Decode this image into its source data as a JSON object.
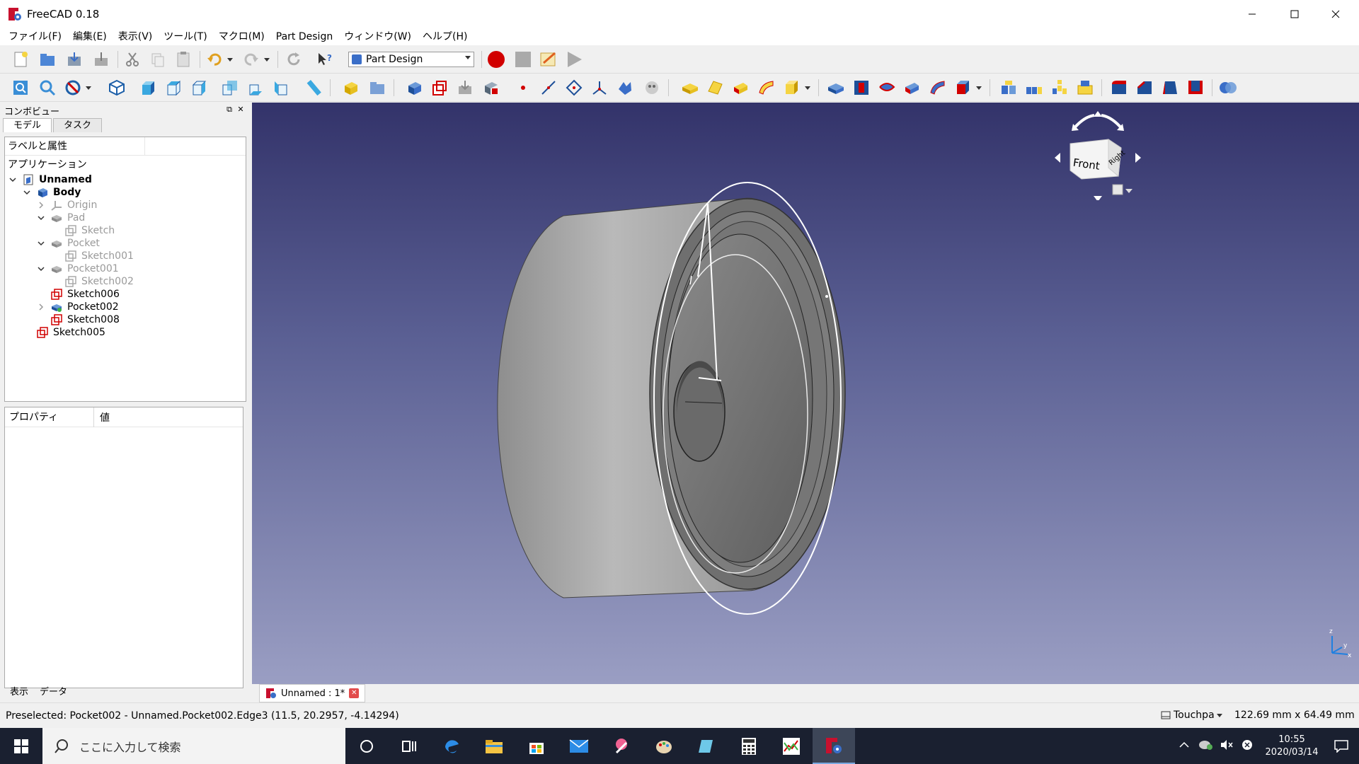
{
  "window": {
    "title": "FreeCAD 0.18",
    "controls": [
      "minimize",
      "maximize",
      "close"
    ]
  },
  "menu": [
    "ファイル(F)",
    "編集(E)",
    "表示(V)",
    "ツール(T)",
    "マクロ(M)",
    "Part Design",
    "ウィンドウ(W)",
    "ヘルプ(H)"
  ],
  "toolbar": {
    "workbench": "Part Design"
  },
  "combo": {
    "title": "コンボビュー",
    "tabs": [
      "モデル",
      "タスク"
    ],
    "tree_header": "ラベルと属性",
    "application_label": "アプリケーション",
    "tree": [
      {
        "label": "Unnamed",
        "bold": true
      },
      {
        "label": "Body",
        "bold": true
      },
      {
        "label": "Origin",
        "grey": true
      },
      {
        "label": "Pad",
        "grey": true
      },
      {
        "label": "Sketch",
        "grey": true
      },
      {
        "label": "Pocket",
        "grey": true
      },
      {
        "label": "Sketch001",
        "grey": true
      },
      {
        "label": "Pocket001",
        "grey": true
      },
      {
        "label": "Sketch002",
        "grey": true
      },
      {
        "label": "Sketch006"
      },
      {
        "label": "Pocket002"
      },
      {
        "label": "Sketch008"
      },
      {
        "label": "Sketch005"
      }
    ],
    "props_col1": "プロパティ",
    "props_col2": "値",
    "props_tabs": [
      "表示",
      "データ"
    ]
  },
  "view_tab": {
    "label": "Unnamed : 1*"
  },
  "navcube": {
    "front": "Front",
    "right": "Right"
  },
  "status": {
    "message": "Preselected: Pocket002 - Unnamed.Pocket002.Edge3 (11.5, 20.2957, -4.14294)",
    "nav_style": "Touchpa",
    "dimensions": "122.69 mm x 64.49 mm"
  },
  "taskbar": {
    "search_placeholder": "ここに入力して検索",
    "time": "10:55",
    "date": "2020/03/14"
  }
}
